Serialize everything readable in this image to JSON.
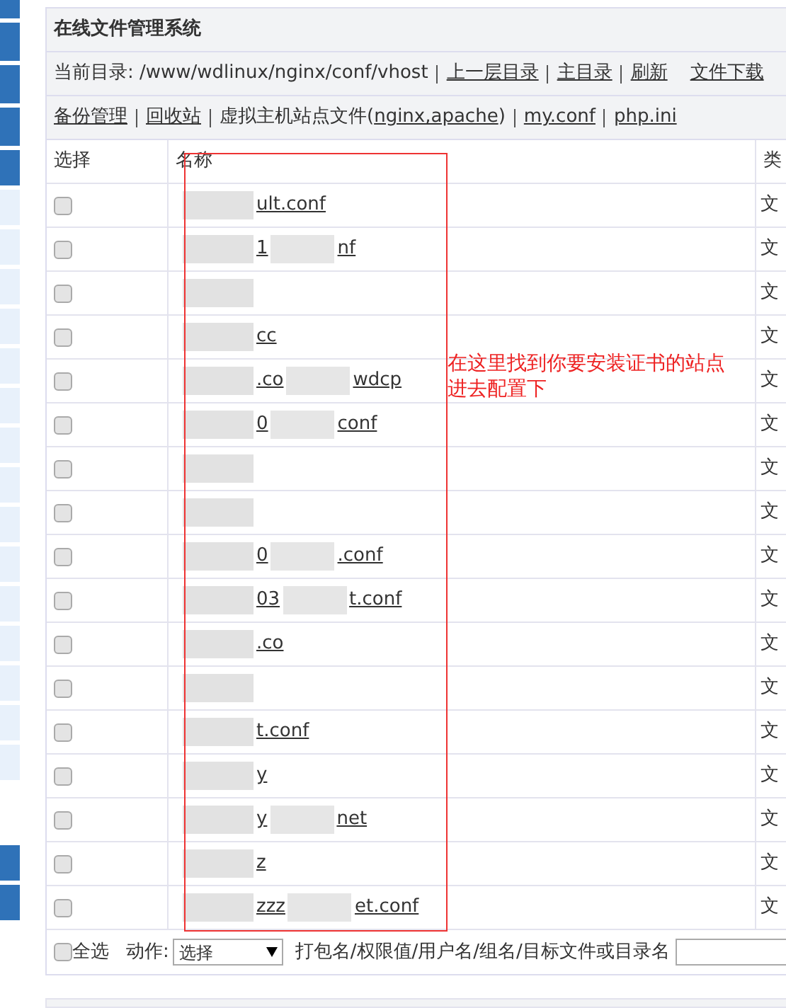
{
  "panel": {
    "title": "在线文件管理系统"
  },
  "path_bar": {
    "label": "当前目录: /www/wdlinux/nginx/conf/vhost",
    "links": [
      "上一层目录",
      "主目录",
      "刷新"
    ],
    "extra_link": "文件下载"
  },
  "tools_bar": [
    {
      "kind": "link",
      "text": "备份管理"
    },
    {
      "kind": "link",
      "text": "回收站"
    },
    {
      "kind": "text",
      "text": "虚拟主机站点文件("
    },
    {
      "kind": "link",
      "text": "nginx,apache"
    },
    {
      "kind": "text",
      "text": ")"
    },
    {
      "kind": "sep"
    },
    {
      "kind": "link",
      "text": "my.conf"
    },
    {
      "kind": "sep"
    },
    {
      "kind": "link",
      "text": "php.ini"
    }
  ],
  "table": {
    "columns": [
      "选择",
      "名称",
      "类"
    ],
    "rows": [
      {
        "checked": false,
        "name": [
          "ult.conf"
        ],
        "type": "文"
      },
      {
        "checked": false,
        "name": [
          "1",
          "nf"
        ],
        "type": "文"
      },
      {
        "checked": false,
        "name": [],
        "type": "文"
      },
      {
        "checked": false,
        "name": [
          "cc"
        ],
        "type": "文"
      },
      {
        "checked": false,
        "name": [
          ".co",
          "wdcp"
        ],
        "type": "文"
      },
      {
        "checked": false,
        "name": [
          "0",
          "conf"
        ],
        "type": "文"
      },
      {
        "checked": false,
        "name": [],
        "type": "文"
      },
      {
        "checked": false,
        "name": [],
        "type": "文"
      },
      {
        "checked": false,
        "name": [
          "0",
          ".conf"
        ],
        "type": "文"
      },
      {
        "checked": false,
        "name": [
          "03",
          "t.conf"
        ],
        "type": "文"
      },
      {
        "checked": false,
        "name": [
          ".co"
        ],
        "type": "文"
      },
      {
        "checked": false,
        "name": [],
        "type": "文"
      },
      {
        "checked": false,
        "name": [
          "t.conf"
        ],
        "type": "文"
      },
      {
        "checked": false,
        "name": [
          "y"
        ],
        "type": "文"
      },
      {
        "checked": false,
        "name": [
          "y",
          "net"
        ],
        "type": "文"
      },
      {
        "checked": false,
        "name": [
          "z"
        ],
        "type": "文"
      },
      {
        "checked": false,
        "name": [
          "zzz",
          "et.conf"
        ],
        "type": "文"
      }
    ]
  },
  "footer": {
    "select_all": {
      "label": "全选",
      "checked": false
    },
    "action_label": "动作:",
    "action_value": "选择",
    "target_label": "打包名/权限值/用户名/组名/目标文件或目录名"
  },
  "annotation": {
    "text": "在这里找到你要安装证书的站点进去配置下"
  }
}
